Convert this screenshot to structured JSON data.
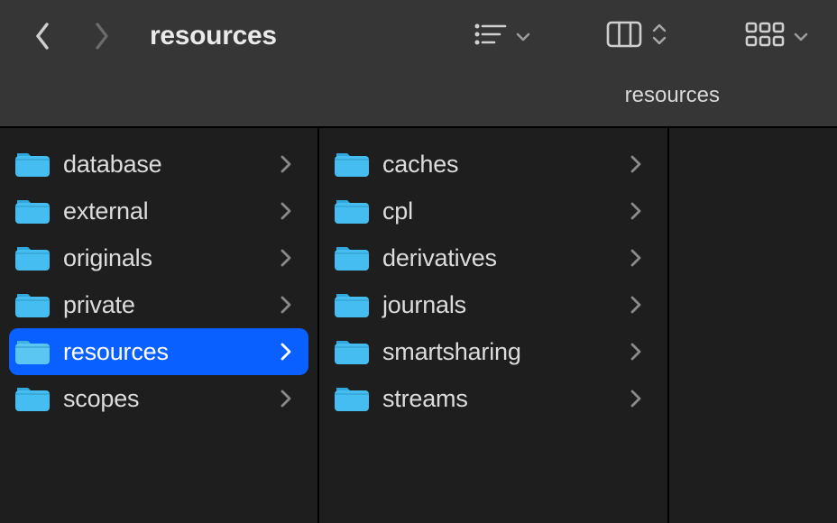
{
  "toolbar": {
    "title": "resources",
    "back_enabled": true,
    "forward_enabled": false
  },
  "pathbar": {
    "current": "resources"
  },
  "columns": [
    {
      "items": [
        {
          "label": "database",
          "has_children": true,
          "selected": false
        },
        {
          "label": "external",
          "has_children": true,
          "selected": false
        },
        {
          "label": "originals",
          "has_children": true,
          "selected": false
        },
        {
          "label": "private",
          "has_children": true,
          "selected": false
        },
        {
          "label": "resources",
          "has_children": true,
          "selected": true
        },
        {
          "label": "scopes",
          "has_children": true,
          "selected": false
        }
      ]
    },
    {
      "items": [
        {
          "label": "caches",
          "has_children": true,
          "selected": false
        },
        {
          "label": "cpl",
          "has_children": true,
          "selected": false
        },
        {
          "label": "derivatives",
          "has_children": true,
          "selected": false
        },
        {
          "label": "journals",
          "has_children": true,
          "selected": false
        },
        {
          "label": "smartsharing",
          "has_children": true,
          "selected": false
        },
        {
          "label": "streams",
          "has_children": true,
          "selected": false
        }
      ]
    },
    {
      "items": []
    }
  ],
  "icons": {
    "view_list": "list-sort-icon",
    "view_columns": "columns-icon",
    "view_grid": "grid-icon"
  }
}
